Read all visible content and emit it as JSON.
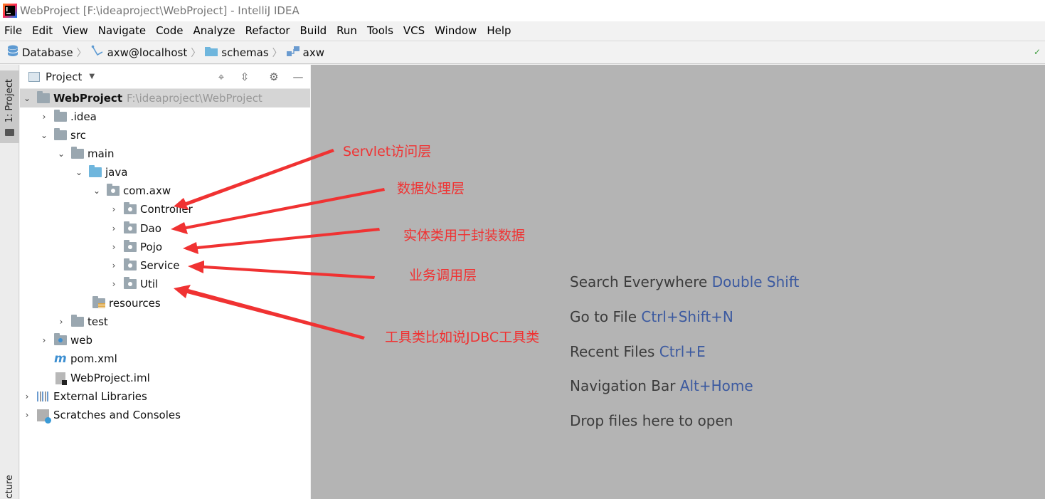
{
  "window": {
    "title": "WebProject [F:\\ideaproject\\WebProject] - IntelliJ IDEA"
  },
  "menu": [
    "File",
    "Edit",
    "View",
    "Navigate",
    "Code",
    "Analyze",
    "Refactor",
    "Build",
    "Run",
    "Tools",
    "VCS",
    "Window",
    "Help"
  ],
  "breadcrumbs": [
    "Database",
    "axw@localhost",
    "schemas",
    "axw"
  ],
  "side_tabs": {
    "project": "1: Project",
    "structure": "cture"
  },
  "panel": {
    "title": "Project"
  },
  "tree": {
    "root": {
      "name": "WebProject",
      "path": "F:\\ideaproject\\WebProject"
    },
    "idea": ".idea",
    "src": "src",
    "main": "main",
    "java": "java",
    "package": "com.axw",
    "controller": "Controller",
    "dao": "Dao",
    "pojo": "Pojo",
    "service": "Service",
    "util": "Util",
    "resources": "resources",
    "test": "test",
    "web": "web",
    "pom": "pom.xml",
    "iml": "WebProject.iml",
    "external_libraries": "External Libraries",
    "scratches": "Scratches and Consoles"
  },
  "editor_hints": [
    {
      "text": "Search Everywhere",
      "key": "Double Shift"
    },
    {
      "text": "Go to File",
      "key": "Ctrl+Shift+N"
    },
    {
      "text": "Recent Files",
      "key": "Ctrl+E"
    },
    {
      "text": "Navigation Bar",
      "key": "Alt+Home"
    },
    {
      "text": "Drop files here to open",
      "key": ""
    }
  ],
  "annotations": {
    "controller": "Servlet访问层",
    "dao": "数据处理层",
    "pojo": "实体类用于封装数据",
    "service": "业务调用层",
    "util": "工具类比如说JDBC工具类"
  },
  "colors": {
    "annotation": "#f03232",
    "editor_bg": "#b4b4b4",
    "hint_key": "#3c5aa0"
  }
}
